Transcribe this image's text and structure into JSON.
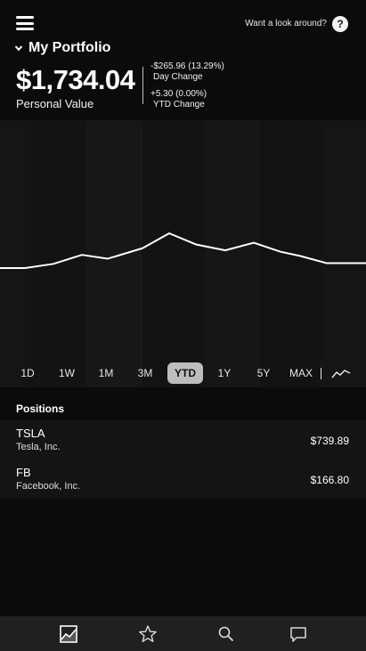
{
  "header": {
    "look_around": "Want a look around?",
    "help": "?",
    "portfolio_title": "My Portfolio",
    "value": "$1,734.04",
    "value_label": "Personal Value",
    "day_change": "-$265.96 (13.29%)",
    "day_change_label": "Day Change",
    "ytd_change": "+5.30 (0.00%)",
    "ytd_change_label": "YTD Change"
  },
  "chart_data": {
    "type": "line",
    "selected_range": "YTD",
    "y_relative": [
      0.0,
      0.0,
      0.12,
      0.38,
      0.27,
      0.57,
      1.0,
      0.68,
      0.51,
      0.73,
      0.47,
      0.35,
      0.14,
      0.14
    ],
    "line_color": "#ffffff"
  },
  "ranges": [
    "1D",
    "1W",
    "1M",
    "3M",
    "YTD",
    "1Y",
    "5Y",
    "MAX"
  ],
  "positions": {
    "title": "Positions",
    "items": [
      {
        "ticker": "TSLA",
        "company": "Tesla, Inc.",
        "price": "$739.89"
      },
      {
        "ticker": "FB",
        "company": "Facebook, Inc.",
        "price": "$166.80"
      }
    ]
  },
  "nav": [
    "portfolio-icon",
    "watchlist-star-icon",
    "search-icon",
    "chat-icon"
  ]
}
